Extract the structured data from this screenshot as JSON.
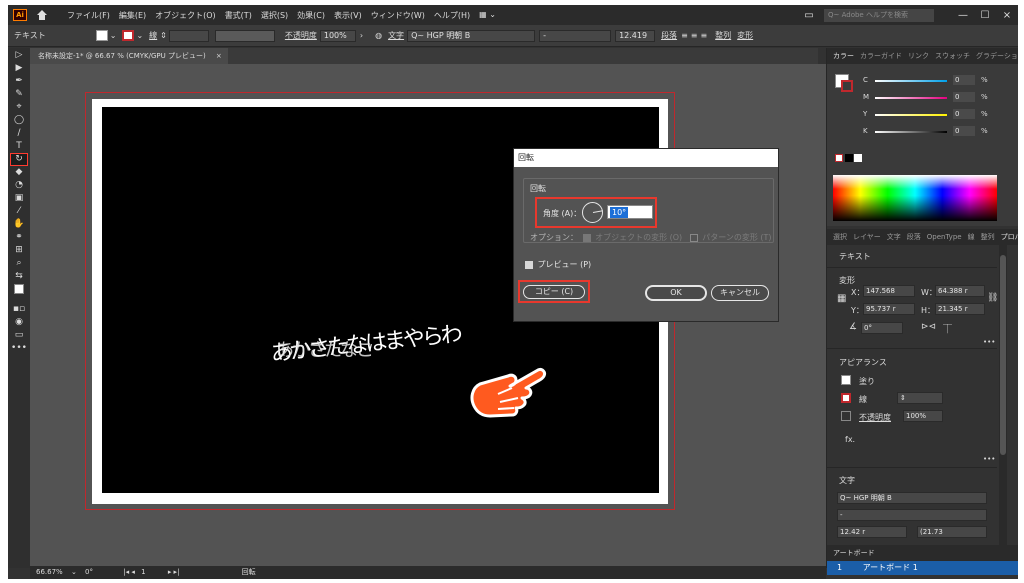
{
  "menubar": {
    "logo": "Ai",
    "items": [
      "ファイル(F)",
      "編集(E)",
      "オブジェクト(O)",
      "書式(T)",
      "選択(S)",
      "効果(C)",
      "表示(V)",
      "ウィンドウ(W)",
      "ヘルプ(H)"
    ],
    "workspace_icon": "grid-icon",
    "search_placeholder": "Q~ Adobe ヘルプを検索",
    "minimize": "—",
    "restore": "☐",
    "close": "×"
  },
  "controlbar": {
    "object_type": "テキスト",
    "stroke_label": "線",
    "opacity_label": "不透明度",
    "opacity_value": "100%",
    "character_label": "文字",
    "font_value": "Q~ HGP 明朝 B",
    "style_value": "-",
    "size_value": "12.419",
    "paragraph_label": "段落",
    "align_label": "整列",
    "transform_label": "変形"
  },
  "document": {
    "tab_title": "名称未設定-1* @ 66.67 % (CMYK/GPU プレビュー)",
    "close": "×"
  },
  "canvas": {
    "art_text": "あかさたなはまやらわ",
    "art_text_2": "あかさたなこ"
  },
  "dialog": {
    "title": "回転",
    "group_label": "回転",
    "angle_label": "角度 (A)：",
    "angle_value": "10°",
    "options_label": "オプション：",
    "transform_objects": "オブジェクトの変形 (O)",
    "transform_patterns": "パターンの変形 (T)",
    "preview_label": "プレビュー (P)",
    "copy_button": "コピー (C)",
    "ok_button": "OK",
    "cancel_button": "キャンセル"
  },
  "color_panel": {
    "tabs": [
      "カラー",
      "カラーガイド",
      "リンク",
      "スウォッチ",
      "グラデーション"
    ],
    "rows": [
      {
        "label": "C",
        "value": "0",
        "unit": "%",
        "color": "#00a0e9"
      },
      {
        "label": "M",
        "value": "0",
        "unit": "%",
        "color": "#e4007f"
      },
      {
        "label": "Y",
        "value": "0",
        "unit": "%",
        "color": "#fff100"
      },
      {
        "label": "K",
        "value": "0",
        "unit": "%",
        "color": "#ffffff"
      }
    ]
  },
  "properties_panel": {
    "tabs": [
      "選択",
      "レイヤー",
      "文字",
      "段落",
      "OpenType",
      "線",
      "整列",
      "プロパティ"
    ],
    "section_text": "テキスト",
    "section_transform": "変形",
    "x_label": "X：",
    "x_value": "147.568",
    "w_label": "W：",
    "w_value": "64.388 r",
    "y_label": "Y：",
    "y_value": "95.737 r",
    "h_label": "H：",
    "h_value": "21.345 r",
    "rotate_value": "0°",
    "section_appearance": "アピアランス",
    "fill_label": "塗り",
    "stroke_label": "線",
    "opacity_label": "不透明度",
    "opacity_value": "100%",
    "fx_label": "fx.",
    "section_character": "文字",
    "font_value": "Q~ HGP 明朝 B",
    "font_style": "-",
    "font_size": "12.42 r",
    "leading": "(21.73",
    "more": "•••"
  },
  "artboards_panel": {
    "header": "アートボード",
    "row_number": "1",
    "row_name": "アートボード 1"
  },
  "statusbar": {
    "zoom": "66.67%",
    "rotation": "0°",
    "artboard": "1",
    "tool": "回転"
  },
  "colors": {
    "highlight": "#e8382d",
    "accent": "#1c6fd8"
  }
}
